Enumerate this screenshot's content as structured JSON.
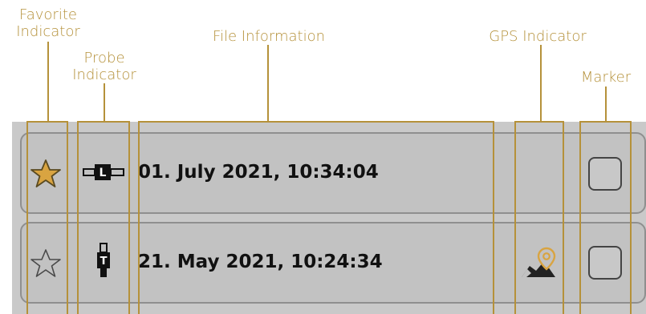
{
  "callouts": {
    "favorite": "Favorite\nIndicator",
    "probe": "Probe\nIndicator",
    "file_info": "File Information",
    "gps": "GPS Indicator",
    "marker": "Marker"
  },
  "rows": [
    {
      "text": "01. July 2021, 10:34:04",
      "favorite": true,
      "probe": "L",
      "gps": false,
      "marked": false
    },
    {
      "text": "21. May 2021, 10:24:34",
      "favorite": false,
      "probe": "T",
      "gps": true,
      "marked": false
    }
  ],
  "colors": {
    "accent": "#b5913a",
    "star_fill": "#d9a441",
    "pin": "#d9a441"
  }
}
